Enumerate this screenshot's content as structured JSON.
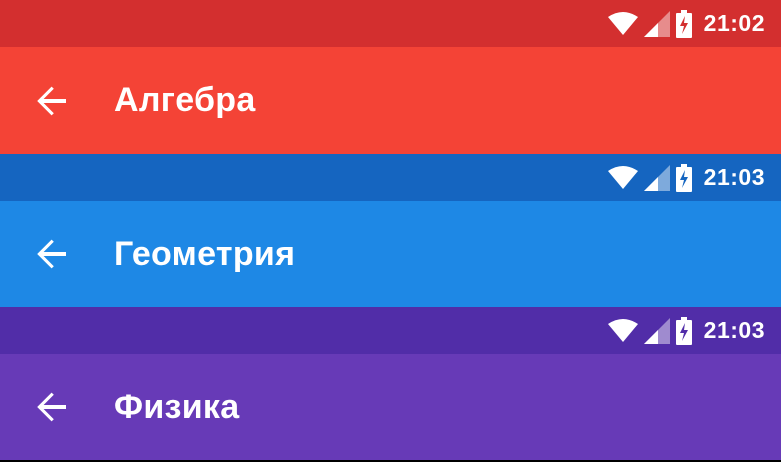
{
  "screens": [
    {
      "title": "Алгебра",
      "time": "21:02",
      "colors": {
        "status": "#D32F2F",
        "appbar": "#F44336"
      },
      "icons": [
        "arrow-back-icon",
        "wifi-icon",
        "cellular-signal-icon",
        "battery-charging-icon"
      ]
    },
    {
      "title": "Геометрия",
      "time": "21:03",
      "colors": {
        "status": "#1565C0",
        "appbar": "#1E88E5"
      },
      "icons": [
        "arrow-back-icon",
        "wifi-icon",
        "cellular-signal-icon",
        "battery-charging-icon"
      ]
    },
    {
      "title": "Физика",
      "time": "21:03",
      "colors": {
        "status": "#512DA8",
        "appbar": "#673AB7"
      },
      "icons": [
        "arrow-back-icon",
        "wifi-icon",
        "cellular-signal-icon",
        "battery-charging-icon"
      ]
    }
  ]
}
